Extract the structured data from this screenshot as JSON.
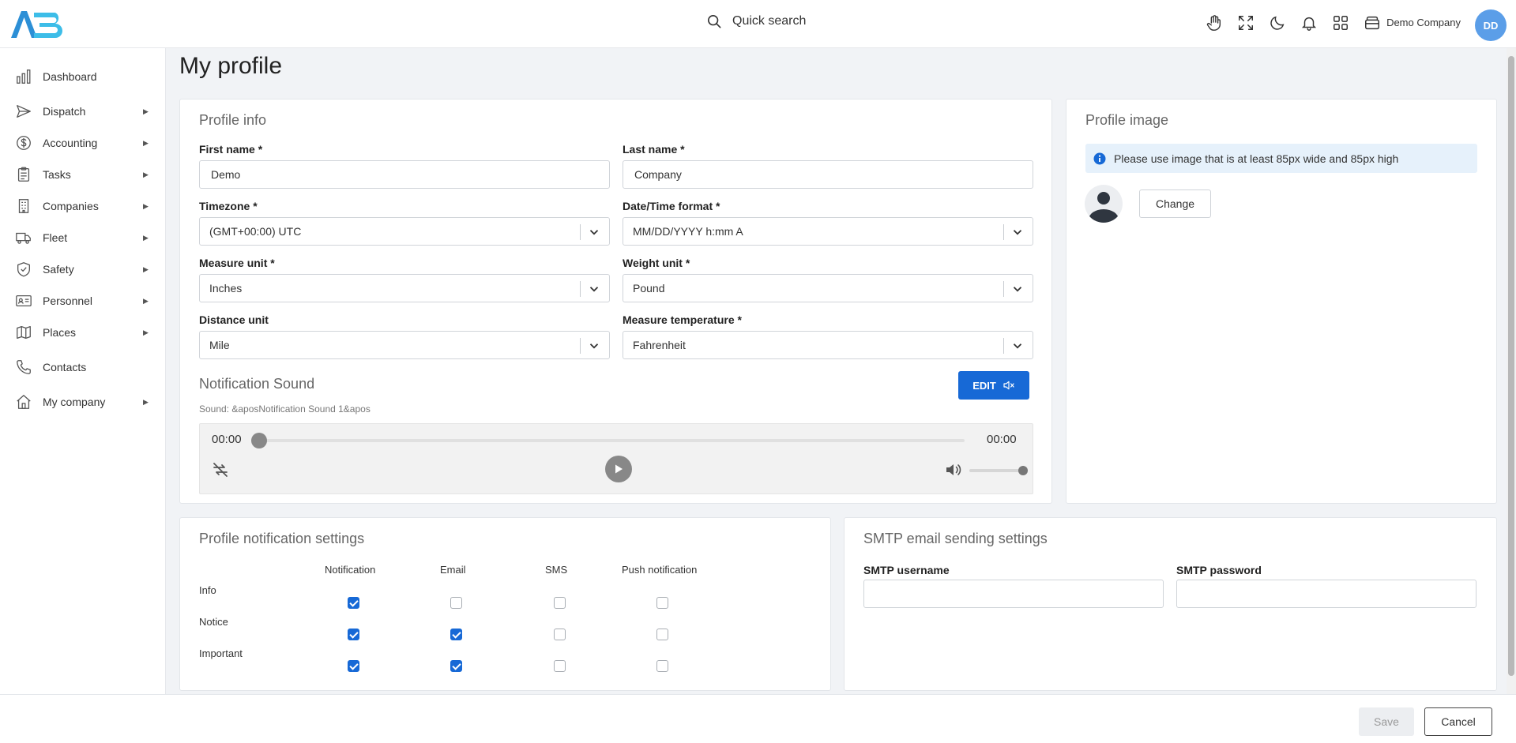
{
  "app": {
    "brand": "AE",
    "search_label": "Quick search",
    "company_name": "Demo Company",
    "user_initials": "DD",
    "top_icons": [
      "hand-icon",
      "fullscreen-icon",
      "moon-icon",
      "bell-icon",
      "apps-grid-icon",
      "wallet-icon"
    ],
    "accent_color": "#1769d6"
  },
  "sidebar": {
    "items": [
      {
        "label": "Dashboard",
        "icon": "chart-bars-icon",
        "has_children": false
      },
      {
        "label": "Dispatch",
        "icon": "send-icon",
        "has_children": true
      },
      {
        "label": "Accounting",
        "icon": "dollar-icon",
        "has_children": true
      },
      {
        "label": "Tasks",
        "icon": "clipboard-icon",
        "has_children": true
      },
      {
        "label": "Companies",
        "icon": "building-icon",
        "has_children": true
      },
      {
        "label": "Fleet",
        "icon": "truck-icon",
        "has_children": true
      },
      {
        "label": "Safety",
        "icon": "shield-icon",
        "has_children": true
      },
      {
        "label": "Personnel",
        "icon": "id-card-icon",
        "has_children": true
      },
      {
        "label": "Places",
        "icon": "map-icon",
        "has_children": true
      },
      {
        "label": "Contacts",
        "icon": "phone-icon",
        "has_children": false
      },
      {
        "label": "My company",
        "icon": "home-icon",
        "has_children": true
      }
    ]
  },
  "page": {
    "title": "My profile"
  },
  "profile_info": {
    "title": "Profile info",
    "first_name": {
      "label": "First name *",
      "value": "Demo"
    },
    "last_name": {
      "label": "Last name *",
      "value": "Company"
    },
    "timezone": {
      "label": "Timezone *",
      "value": "(GMT+00:00) UTC"
    },
    "datetime_format": {
      "label": "Date/Time format *",
      "value": "MM/DD/YYYY h:mm A"
    },
    "measure_unit": {
      "label": "Measure unit *",
      "value": "Inches"
    },
    "weight_unit": {
      "label": "Weight unit *",
      "value": "Pound"
    },
    "distance_unit": {
      "label": "Distance unit",
      "value": "Mile"
    },
    "measure_temperature": {
      "label": "Measure temperature *",
      "value": "Fahrenheit"
    }
  },
  "notification_sound": {
    "title": "Notification Sound",
    "edit_label": "EDIT",
    "sound_text": "Sound: &aposNotification Sound 1&apos",
    "current_time": "00:00",
    "duration": "00:00",
    "progress": 0,
    "volume": 1.0
  },
  "profile_image": {
    "title": "Profile image",
    "info_text": "Please use image that is at least 85px wide and 85px high",
    "change_label": "Change"
  },
  "notification_settings": {
    "title": "Profile notification settings",
    "columns": [
      "Notification",
      "Email",
      "SMS",
      "Push notification"
    ],
    "rows": [
      {
        "label": "Info",
        "checks": [
          true,
          false,
          false,
          false
        ]
      },
      {
        "label": "Notice",
        "checks": [
          true,
          true,
          false,
          false
        ]
      },
      {
        "label": "Important",
        "checks": [
          true,
          true,
          false,
          false
        ]
      }
    ]
  },
  "smtp": {
    "title": "SMTP email sending settings",
    "username_label": "SMTP username",
    "username_value": "",
    "password_label": "SMTP password",
    "password_value": ""
  },
  "footer": {
    "save_label": "Save",
    "cancel_label": "Cancel"
  }
}
